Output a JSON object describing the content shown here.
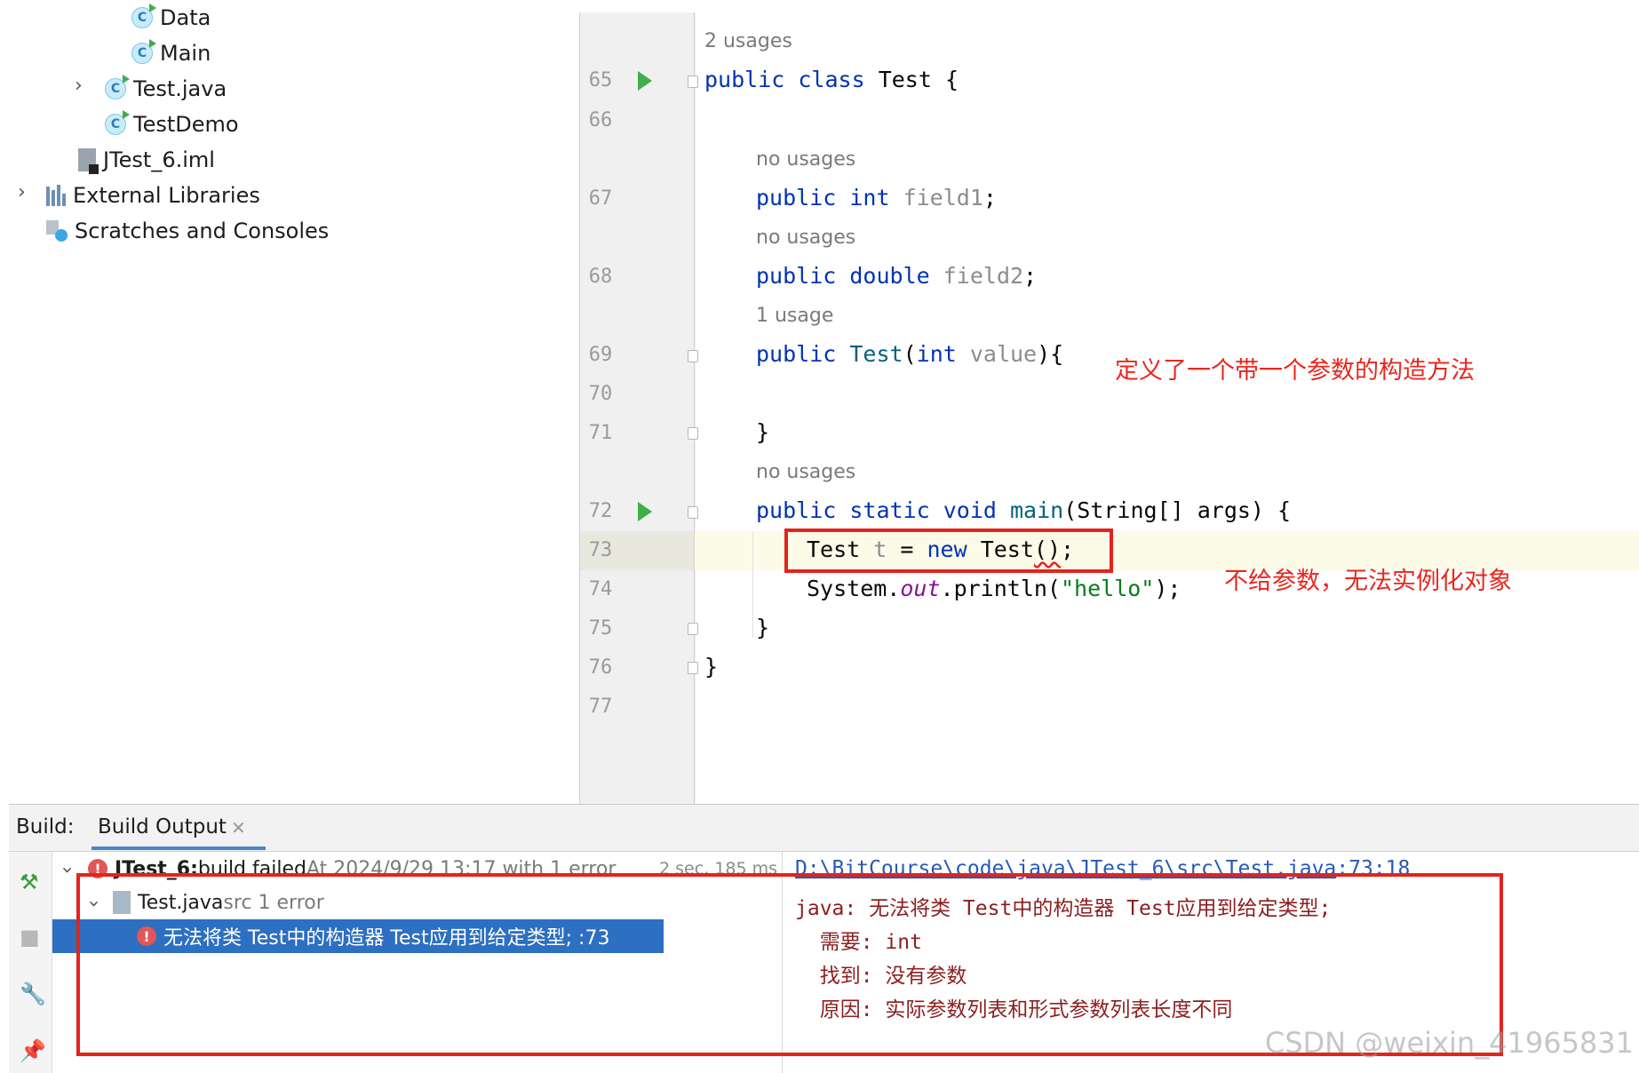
{
  "project_tree": {
    "items": [
      {
        "label": "Data",
        "icon": "class-icon"
      },
      {
        "label": "Main",
        "icon": "class-icon"
      },
      {
        "label": "Test.java",
        "icon": "class-icon"
      },
      {
        "label": "TestDemo",
        "icon": "class-icon"
      },
      {
        "label": "JTest_6.iml",
        "icon": "module-file-icon"
      },
      {
        "label": "External Libraries",
        "icon": "library-icon"
      },
      {
        "label": "Scratches and Consoles",
        "icon": "scratch-icon"
      }
    ]
  },
  "editor": {
    "line_numbers": [
      "65",
      "66",
      "67",
      "68",
      "69",
      "70",
      "71",
      "72",
      "73",
      "74",
      "75",
      "76",
      "77"
    ],
    "hints": {
      "class_usages": "2 usages",
      "field1_usages": "no usages",
      "field2_usages": "no usages",
      "ctor_usages": "1 usage",
      "main_usages": "no usages"
    },
    "code": {
      "l65_kw1": "public",
      "l65_kw2": "class",
      "l65_rest": " Test {",
      "l67_kw1": "public",
      "l67_kw2": "int",
      "l67_name": " field1",
      "l67_end": ";",
      "l68_kw1": "public",
      "l68_kw2": "double",
      "l68_name": " field2",
      "l68_end": ";",
      "l69_kw": "public",
      "l69_fn": " Test",
      "l69_open": "(",
      "l69_type": "int",
      "l69_param": " value",
      "l69_close": "){",
      "l71": "}",
      "l72_kw": "public static void",
      "l72_fn": " main",
      "l72_rest": "(String[] args) {",
      "l73_a": "Test",
      "l73_var": " t",
      "l73_eq": " = ",
      "l73_new": "new",
      "l73_b": " Test",
      "l73_paren": "()",
      "l73_end": ";",
      "l74_a": "System.",
      "l74_out": "out",
      "l74_b": ".println(",
      "l74_str": "\"hello\"",
      "l74_c": ");",
      "l75": "}",
      "l76": "}"
    },
    "annotations": {
      "constructor_note": "定义了一个带一个参数的构造方法",
      "error_note": "不给参数，无法实例化对象"
    }
  },
  "build": {
    "label": "Build:",
    "tab": "Build Output",
    "tree": {
      "root_name": "JTest_6:",
      "root_status": " build failed",
      "root_detail": " At 2024/9/29 13:17 with 1 error",
      "root_time": "2 sec, 185 ms",
      "file_name": "Test.java",
      "file_detail": " src 1 error",
      "error_message": "无法将类 Test中的构造器 Test应用到给定类型; :73"
    },
    "detail": {
      "path": "D:\\BitCourse\\code\\java\\JTest_6\\src\\Test.java",
      "position": ":73:18",
      "line1": "java: 无法将类 Test中的构造器 Test应用到给定类型;",
      "line2": "  需要: int",
      "line3": "  找到: 没有参数",
      "line4": "  原因: 实际参数列表和形式参数列表长度不同"
    }
  },
  "watermark": "CSDN @weixin_41965831",
  "colors": {
    "keyword": "#0033b3",
    "annotation_red": "#e8281e",
    "selection": "#2d6fc0"
  }
}
